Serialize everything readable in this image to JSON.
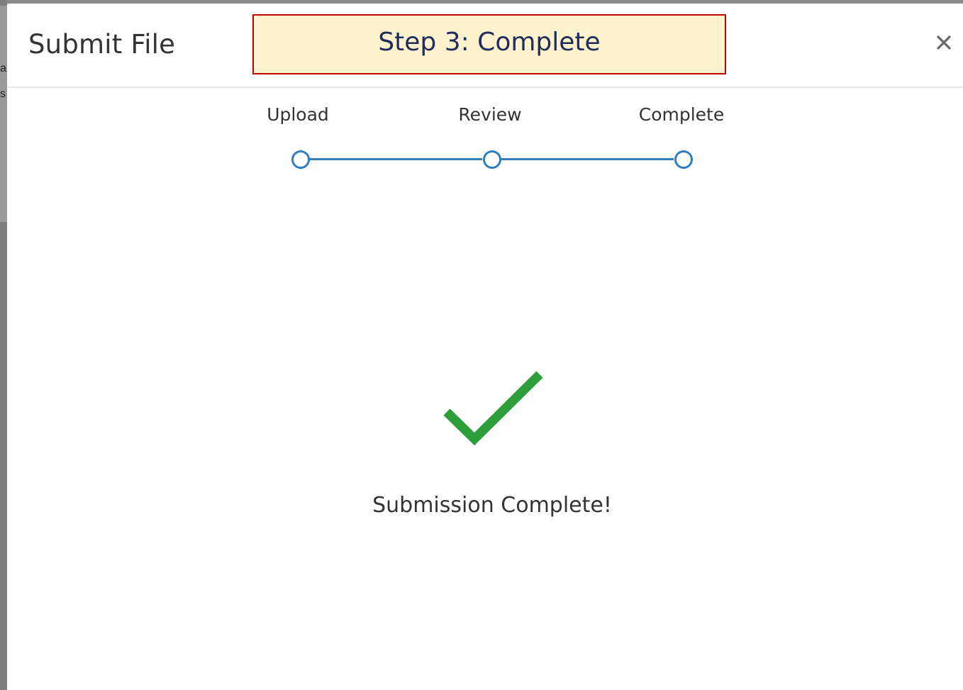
{
  "background": {
    "fragment_a": "a",
    "fragment_b": "s"
  },
  "modal": {
    "title": "Submit File",
    "step_banner": "Step 3: Complete",
    "close_label": "×"
  },
  "stepper": {
    "steps": [
      {
        "label": "Upload"
      },
      {
        "label": "Review"
      },
      {
        "label": "Complete"
      }
    ],
    "accent_color": "#2e7ec1"
  },
  "result": {
    "icon": "checkmark-icon",
    "icon_color": "#2e9e3a",
    "message": "Submission Complete!"
  }
}
